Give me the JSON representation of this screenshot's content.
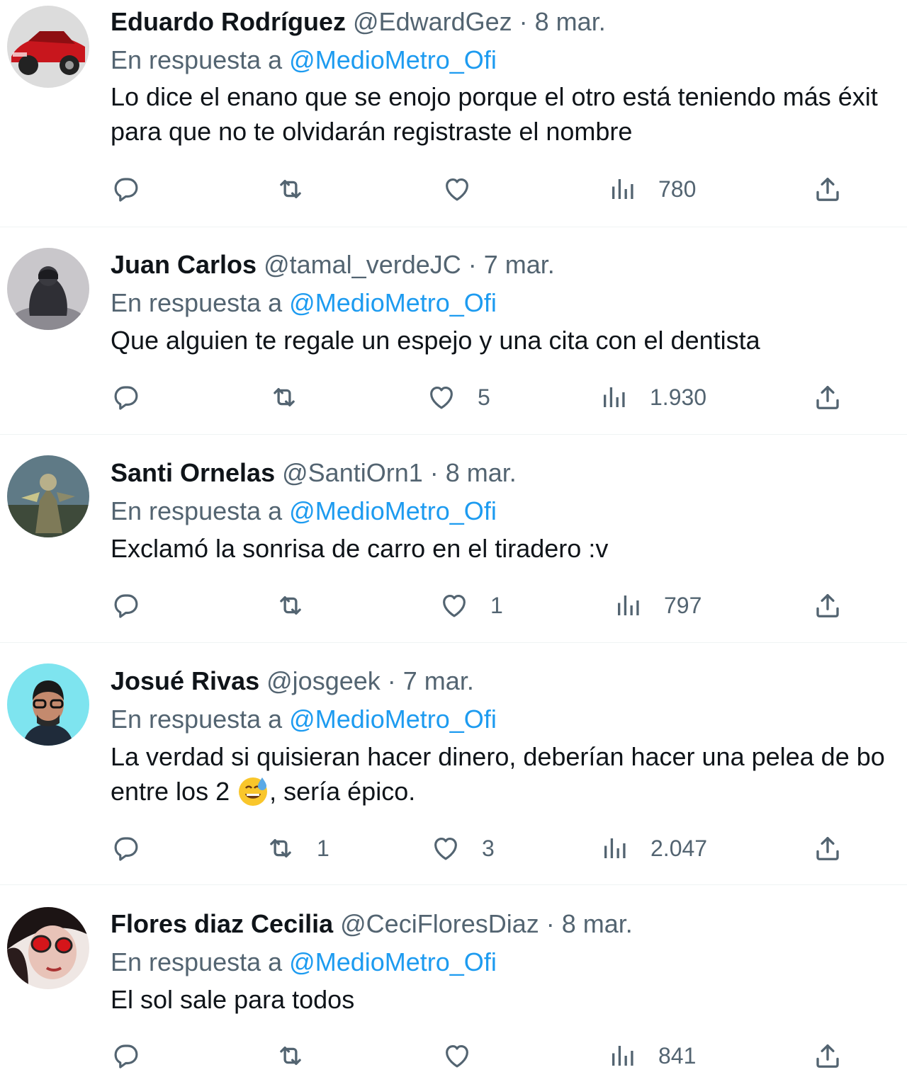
{
  "replying_prefix": "En respuesta a",
  "tweets": [
    {
      "name": "Eduardo Rodríguez",
      "handle": "@EdwardGez",
      "date": "· 8 mar.",
      "reply_to": "@MedioMetro_Ofi",
      "text_lines": [
        "Lo dice el enano que se enojo porque el otro está teniendo más éxit",
        "para que no te olvidarán registraste el nombre"
      ],
      "retweets": "",
      "likes": "",
      "views": "780",
      "avatar": "red-car-avatar"
    },
    {
      "name": "Juan Carlos",
      "handle": "@tamal_verdeJC",
      "date": "· 7 mar.",
      "reply_to": "@MedioMetro_Ofi",
      "text_lines": [
        "Que alguien te regale un espejo y una cita con el dentista"
      ],
      "retweets": "",
      "likes": "5",
      "views": "1.930",
      "avatar": "hooded-person-avatar"
    },
    {
      "name": "Santi Ornelas",
      "handle": "@SantiOrn1",
      "date": "· 8 mar.",
      "reply_to": "@MedioMetro_Ofi",
      "text_lines": [
        "Exclamó la sonrisa de carro en el tiradero :v"
      ],
      "retweets": "",
      "likes": "1",
      "views": "797",
      "avatar": "game-character-avatar"
    },
    {
      "name": "Josué Rivas",
      "handle": "@josgeek",
      "date": "· 7 mar.",
      "reply_to": "@MedioMetro_Ofi",
      "text_lines": [
        "La verdad si quisieran hacer dinero, deberían hacer una pelea de bo",
        "entre los 2",
        ", sería épico."
      ],
      "retweets": "1",
      "likes": "3",
      "views": "2.047",
      "avatar": "glasses-man-avatar"
    },
    {
      "name": "Flores diaz Cecilia",
      "handle": "@CeciFloresDiaz",
      "date": "· 8 mar.",
      "reply_to": "@MedioMetro_Ofi",
      "text_lines": [
        "El sol sale para todos"
      ],
      "retweets": "",
      "likes": "",
      "views": "841",
      "avatar": "woman-red-glasses-avatar"
    }
  ],
  "icons": {
    "reply": "reply-bubble-icon",
    "retweet": "retweet-icon",
    "like": "heart-icon",
    "views": "views-bars-icon",
    "share": "share-upload-icon",
    "emoji": "grinning-sweat-emoji"
  },
  "colors": {
    "link": "#1d9bf0",
    "secondary": "#536471",
    "primary": "#0f1419",
    "divider": "#eff3f4"
  }
}
